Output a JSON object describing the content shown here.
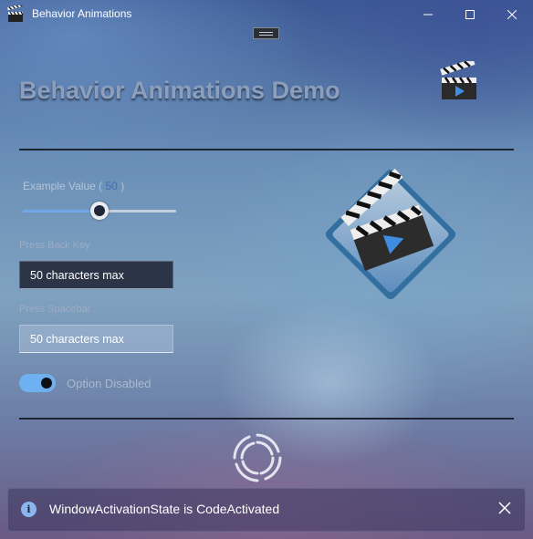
{
  "window": {
    "title": "Behavior Animations",
    "icon": "clapperboard-icon",
    "controls": [
      "minimize-icon",
      "maximize-icon",
      "close-icon"
    ]
  },
  "header": {
    "title": "Behavior Animations Demo",
    "icon": "clapperboard-icon"
  },
  "slider": {
    "label_prefix": "Example Value (",
    "value": "50",
    "label_suffix": ")",
    "fraction": 0.5
  },
  "field_back": {
    "label": "Press Back Key",
    "value": "50 characters max"
  },
  "field_space": {
    "label": "Press Spacebar",
    "value": "50 characters max"
  },
  "toggle": {
    "label": "Option Disabled",
    "state": "on"
  },
  "spinner": {
    "icon": "loading-spinner-icon"
  },
  "infobar": {
    "icon": "info-icon",
    "symbol": "i",
    "message": "WindowActivationState is CodeActivated",
    "close_icon": "close-icon"
  },
  "colors": {
    "accent": "#6fb1f0",
    "heading": "#8b9fbd",
    "slider_value": "#3f6fb8"
  }
}
